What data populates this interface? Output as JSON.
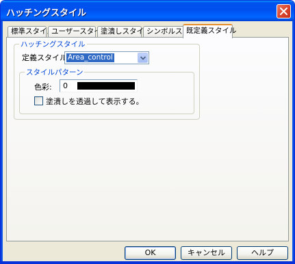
{
  "window": {
    "title": "ハッチングスタイル"
  },
  "tabs": [
    {
      "label": "標準スタイル",
      "active": false
    },
    {
      "label": "ユーザースタイル",
      "active": false
    },
    {
      "label": "塗潰しスタイル",
      "active": false
    },
    {
      "label": "シンボルスタイル",
      "active": false
    },
    {
      "label": "既定義スタイル",
      "active": true
    }
  ],
  "hatching_group": {
    "legend": "ハッチングスタイル",
    "defined_style_label": "定義スタイル:",
    "defined_style_value": "Area_control"
  },
  "pattern_group": {
    "legend": "スタイルパターン",
    "color_label": "色彩:",
    "color_index": "0",
    "color_value": "#000000",
    "transparent_label": "塗潰しを透過して表示する。",
    "transparent_checked": false
  },
  "buttons": {
    "ok": "OK",
    "cancel": "キャンセル",
    "help": "ヘルプ"
  },
  "colors": {
    "title_blue": "#0053ee",
    "group_legend": "#0046d5",
    "selection": "#316ac5",
    "active_tab_accent": "#e68b2c"
  }
}
